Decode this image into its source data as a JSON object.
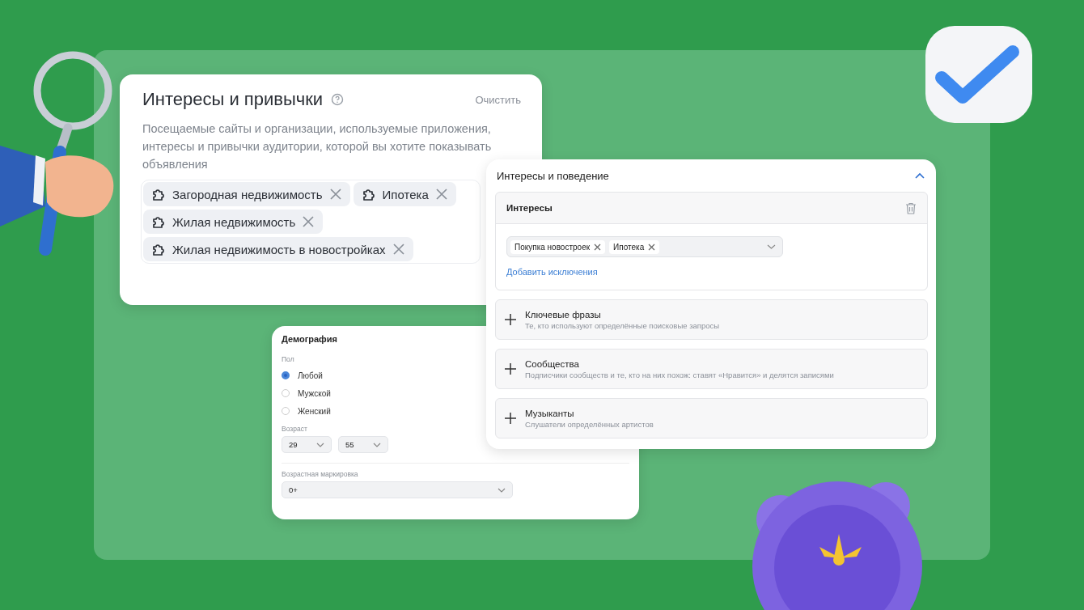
{
  "interests_card": {
    "title": "Интересы и привычки",
    "clear_link": "Очистить",
    "description": "Посещаемые сайты и организации, используемые приложения, интересы и привычки аудитории, которой вы хотите показывать объявления",
    "chips": [
      {
        "label": "Загородная недвижимость"
      },
      {
        "label": "Ипотека"
      },
      {
        "label": "Жилая недвижимость"
      },
      {
        "label": "Жилая недвижимость в новостройках"
      }
    ]
  },
  "demography_card": {
    "title": "Демография",
    "gender": {
      "label": "Пол",
      "options": [
        {
          "label": "Любой",
          "selected": true
        },
        {
          "label": "Мужской",
          "selected": false
        },
        {
          "label": "Женский",
          "selected": false
        }
      ]
    },
    "age": {
      "label": "Возраст",
      "from": "29",
      "to": "55"
    },
    "age_rating": {
      "label": "Возрастная маркировка",
      "value": "0+"
    }
  },
  "behavior_card": {
    "title": "Интересы и поведение",
    "expanded": true,
    "interests": {
      "title": "Интересы",
      "tags": [
        "Покупка новостроек",
        "Ипотека"
      ],
      "exclusions_link": "Добавить исключения"
    },
    "sections": [
      {
        "title": "Ключевые фразы",
        "subtitle": "Те, кто используют определённые поисковые запросы"
      },
      {
        "title": "Сообщества",
        "subtitle": "Подписчики сообществ и те, кто на них похож: ставят «Нравится» и делятся записями"
      },
      {
        "title": "Музыканты",
        "subtitle": "Слушатели определённых артистов"
      }
    ]
  }
}
